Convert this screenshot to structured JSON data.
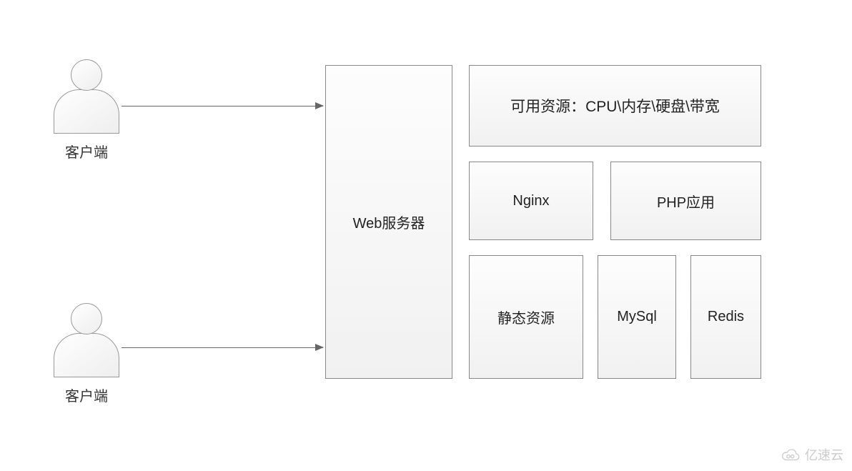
{
  "clients": [
    {
      "label": "客户端"
    },
    {
      "label": "客户端"
    }
  ],
  "server": {
    "label": "Web服务器"
  },
  "resources": {
    "label": "可用资源：CPU\\内存\\硬盘\\带宽"
  },
  "row2": {
    "nginx": "Nginx",
    "php": "PHP应用"
  },
  "row3": {
    "static": "静态资源",
    "mysql": "MySql",
    "redis": "Redis"
  },
  "watermark": "亿速云"
}
